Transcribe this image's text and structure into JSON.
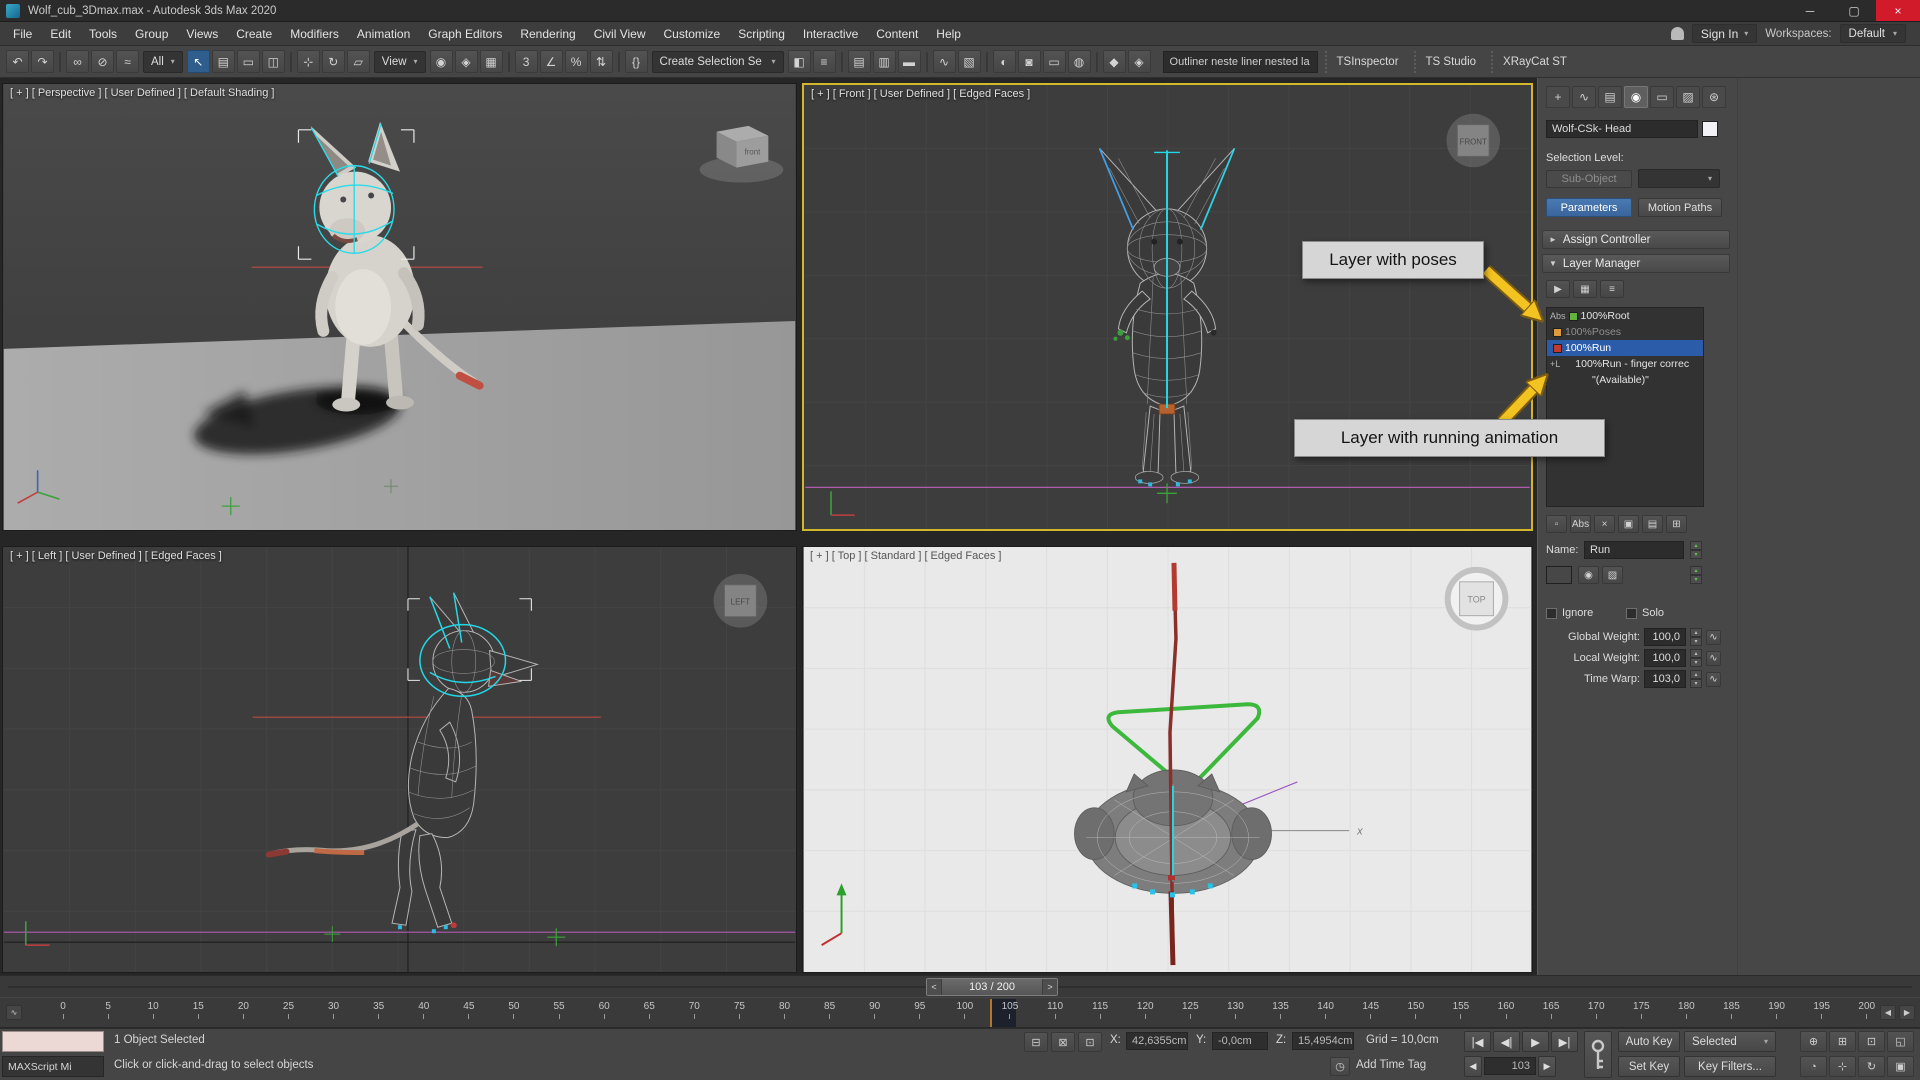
{
  "window": {
    "title": "Wolf_cub_3Dmax.max - Autodesk 3ds Max 2020",
    "controls": [
      {
        "name": "minimize-button",
        "glyph": "─"
      },
      {
        "name": "maximize-button",
        "glyph": "▢"
      },
      {
        "name": "close-button",
        "glyph": "×",
        "state": "close"
      }
    ]
  },
  "menu": {
    "items": [
      "File",
      "Edit",
      "Tools",
      "Group",
      "Views",
      "Create",
      "Modifiers",
      "Animation",
      "Graph Editors",
      "Rendering",
      "Civil View",
      "Customize",
      "Scripting",
      "Interactive",
      "Content",
      "Help"
    ],
    "sign_in": "Sign In",
    "workspaces_label": "Workspaces:",
    "workspace_value": "Default"
  },
  "toolbar": {
    "seg_a": [
      {
        "name": "undo-icon",
        "glyph": "↶"
      },
      {
        "name": "redo-icon",
        "glyph": "↷"
      },
      {
        "state": "sep"
      },
      {
        "name": "select-link-icon",
        "glyph": "∞"
      },
      {
        "name": "unlink-selection-icon",
        "glyph": "⊘"
      },
      {
        "name": "bind-to-spacewarp-icon",
        "glyph": "≈"
      }
    ],
    "filter_dropdown": "All",
    "seg_b": [
      {
        "name": "select-object-icon",
        "glyph": "↖",
        "state": "active"
      },
      {
        "name": "select-by-name-icon",
        "glyph": "▤"
      },
      {
        "name": "rectangular-selection-icon",
        "glyph": "▭"
      },
      {
        "name": "window-crossing-icon",
        "glyph": "◫"
      },
      {
        "state": "sep"
      },
      {
        "name": "select-move-icon",
        "glyph": "⊹"
      },
      {
        "name": "select-rotate-icon",
        "glyph": "↻"
      },
      {
        "name": "select-scale-icon",
        "glyph": "▱"
      }
    ],
    "coord_dropdown": "View",
    "seg_c": [
      {
        "name": "use-pivot-center-icon",
        "glyph": "◉"
      },
      {
        "name": "select-manipulate-icon",
        "glyph": "◈"
      },
      {
        "name": "keyboard-override-icon",
        "glyph": "▦"
      },
      {
        "state": "sep"
      },
      {
        "name": "snap-toggle-icon",
        "glyph": "3"
      },
      {
        "name": "angle-snap-icon",
        "glyph": "∠"
      },
      {
        "name": "percent-snap-icon",
        "glyph": "%"
      },
      {
        "name": "spinner-snap-icon",
        "glyph": "⇅"
      },
      {
        "state": "sep"
      },
      {
        "name": "named-selection-sets-icon",
        "glyph": "{}"
      }
    ],
    "selection_set_dropdown": "Create Selection Se",
    "seg_d": [
      {
        "name": "mirror-icon",
        "glyph": "◧"
      },
      {
        "name": "align-icon",
        "glyph": "≡"
      },
      {
        "state": "sep"
      },
      {
        "name": "scene-explorer-icon",
        "glyph": "▤"
      },
      {
        "name": "layer-explorer-icon",
        "glyph": "▥"
      },
      {
        "name": "ribbon-toggle-icon",
        "glyph": "▬"
      },
      {
        "state": "sep"
      },
      {
        "name": "curve-editor-icon",
        "glyph": "∿"
      },
      {
        "name": "schematic-view-icon",
        "glyph": "▧"
      },
      {
        "state": "sep"
      },
      {
        "name": "material-editor-icon",
        "glyph": "◐"
      },
      {
        "name": "render-setup-icon",
        "glyph": "◙"
      },
      {
        "name": "rendered-frame-window-icon",
        "glyph": "▭"
      },
      {
        "name": "render-production-icon",
        "glyph": "◍"
      },
      {
        "state": "sep"
      },
      {
        "name": "render-plugin-icon",
        "glyph": "◆"
      },
      {
        "name": "render-plugin-alt-icon",
        "glyph": "◈"
      }
    ],
    "outliner_field": "Outliner neste liner nested la",
    "plugin_tabs": [
      "TSInspector",
      "TS Studio",
      "XRayCat ST"
    ]
  },
  "viewports": {
    "persp": {
      "label": "[ + ] [ Perspective ] [ User Defined ] [ Default Shading ]",
      "cube_label": "front"
    },
    "front": {
      "label": "[ + ] [ Front ] [ User Defined ] [ Edged Faces ]",
      "cube_label": "FRONT"
    },
    "left": {
      "label": "[ + ] [ Left ] [ User Defined ] [ Edged Faces ]",
      "cube_label": "LEFT"
    },
    "top": {
      "label": "[ + ] [ Top ] [ Standard ] [ Edged Faces ]",
      "cube_label": "TOP",
      "axis_x": "x"
    }
  },
  "annotations": {
    "poses_label": "Layer with poses",
    "running_label": "Layer with running animation"
  },
  "panel": {
    "tabs": [
      {
        "name": "create-tab-icon",
        "glyph": "+"
      },
      {
        "name": "modify-tab-icon",
        "glyph": "∿"
      },
      {
        "name": "hierarchy-tab-icon",
        "glyph": "▤"
      },
      {
        "name": "motion-tab-icon",
        "glyph": "◉",
        "state": "active"
      },
      {
        "name": "display-tab-icon",
        "glyph": "▭"
      },
      {
        "name": "utilities-tab-icon",
        "glyph": "▨"
      },
      {
        "name": "panel-menu-icon",
        "glyph": "⊛"
      }
    ],
    "object_name": "Wolf-CSk- Head",
    "selection_level_label": "Selection Level:",
    "sub_object_button": "Sub-Object",
    "parameters_button": "Parameters",
    "motion_paths_button": "Motion Paths",
    "assign_controller_rollout": "Assign Controller",
    "layer_manager_rollout": "Layer Manager",
    "layer_tools": [
      {
        "name": "enable-anim-layers-icon",
        "glyph": "▶",
        "state": "green"
      },
      {
        "name": "select-layered-nodes-icon",
        "glyph": "▦"
      },
      {
        "name": "anim-layer-properties-icon",
        "glyph": "≡"
      }
    ],
    "layers": [
      {
        "name": "layer-root",
        "prefix": "Abs",
        "chip": "#62b23c",
        "label": "100%Root"
      },
      {
        "name": "layer-poses",
        "prefix": "",
        "chip": "#de9b3c",
        "label": "100%Poses",
        "state": "dim"
      },
      {
        "name": "layer-run",
        "prefix": "",
        "chip": "#c23a2e",
        "label": "100%Run",
        "state": "selected"
      },
      {
        "name": "layer-run-finger",
        "prefix": "+L",
        "chip": "",
        "label": "100%Run - finger correc"
      },
      {
        "name": "layer-available",
        "prefix": "",
        "chip": "",
        "label": "\"(Available)\"",
        "state": "indent"
      }
    ],
    "list_tools": [
      {
        "name": "layer-weight-icon",
        "glyph": "▫"
      },
      {
        "name": "abs-relative-toggle",
        "glyph": "Abs"
      },
      {
        "name": "delete-layer-icon",
        "glyph": "×",
        "state": "red"
      },
      {
        "name": "copy-layer-icon",
        "glyph": "▣"
      },
      {
        "name": "paste-layer-icon",
        "glyph": "▤"
      },
      {
        "name": "collapse-layer-icon",
        "glyph": "⊞"
      }
    ],
    "name_label": "Name:",
    "name_value": "Run",
    "layer_color_swatch": "#cfe0ae",
    "layer_buttons": [
      {
        "name": "layer-radioactive-icon",
        "glyph": "◉",
        "state": "green"
      },
      {
        "name": "layer-output-icon",
        "glyph": "▨"
      }
    ],
    "ignore_label": "Ignore",
    "solo_label": "Solo",
    "weights": [
      {
        "name": "global-weight-row",
        "label": "Global Weight:",
        "value": "100,0"
      },
      {
        "name": "local-weight-row",
        "label": "Local Weight:",
        "value": "100,0"
      },
      {
        "name": "time-warp-row",
        "label": "Time Warp:",
        "value": "103,0"
      }
    ]
  },
  "timeline": {
    "slider_text": "103 / 200",
    "prev_glyph": "<",
    "next_glyph": ">",
    "current_frame": 103,
    "total_frames": 200,
    "ticks": [
      "0",
      "5",
      "10",
      "15",
      "20",
      "25",
      "30",
      "35",
      "40",
      "45",
      "50",
      "55",
      "60",
      "65",
      "70",
      "75",
      "80",
      "85",
      "90",
      "95",
      "100",
      "105",
      "110",
      "115",
      "120",
      "125",
      "130",
      "135",
      "140",
      "145",
      "150",
      "155",
      "160",
      "165",
      "170",
      "175",
      "180",
      "185",
      "190",
      "195",
      "200"
    ]
  },
  "status": {
    "listener_label": "MAXScript Mi",
    "selection_text": "1 Object Selected",
    "prompt_text": "Click or click-and-drag to select objects",
    "toggle_icons": [
      {
        "name": "isolate-selection-icon",
        "glyph": "⊟"
      },
      {
        "name": "selection-lock-icon",
        "glyph": "⊠"
      },
      {
        "name": "absolute-mode-icon",
        "glyph": "⊡"
      }
    ],
    "x_label": "X:",
    "x_value": "42,6355cm",
    "y_label": "Y:",
    "y_value": "-0,0cm",
    "z_label": "Z:",
    "z_value": "15,4954cm",
    "grid_text": "Grid = 10,0cm",
    "time_tag_icon": "◷",
    "add_time_tag": "Add Time Tag",
    "playback": [
      {
        "name": "go-to-start-button",
        "glyph": "|◀"
      },
      {
        "name": "previous-frame-button",
        "glyph": "◀|"
      },
      {
        "name": "play-button",
        "glyph": "▶"
      },
      {
        "name": "go-to-end-button",
        "glyph": "▶|"
      }
    ],
    "prev_key_glyph": "◀",
    "next_key_glyph": "▶",
    "frame_value": "103",
    "auto_key": "Auto Key",
    "set_key": "Set Key",
    "selection_set_value": "Selected",
    "key_filters": "Key Filters...",
    "nav_row1": [
      {
        "name": "zoom-icon",
        "glyph": "⊕"
      },
      {
        "name": "zoom-all-icon",
        "glyph": "⊞"
      },
      {
        "name": "zoom-extents-icon",
        "glyph": "⊡"
      },
      {
        "name": "zoom-extents-all-icon",
        "glyph": "◱"
      }
    ],
    "nav_row2": [
      {
        "name": "fov-icon",
        "glyph": "◔"
      },
      {
        "name": "pan-icon",
        "glyph": "⊹"
      },
      {
        "name": "orbit-icon",
        "glyph": "↻"
      },
      {
        "name": "maximize-viewport-icon",
        "glyph": "▣"
      }
    ]
  },
  "icons": {
    "caret_down": "▾",
    "spin_up": "▴",
    "spin_down": "▾",
    "curve": "∿",
    "rollout_open": "▼",
    "rollout_closed": "►",
    "prev_tick": "◀",
    "next_tick": "▶"
  }
}
